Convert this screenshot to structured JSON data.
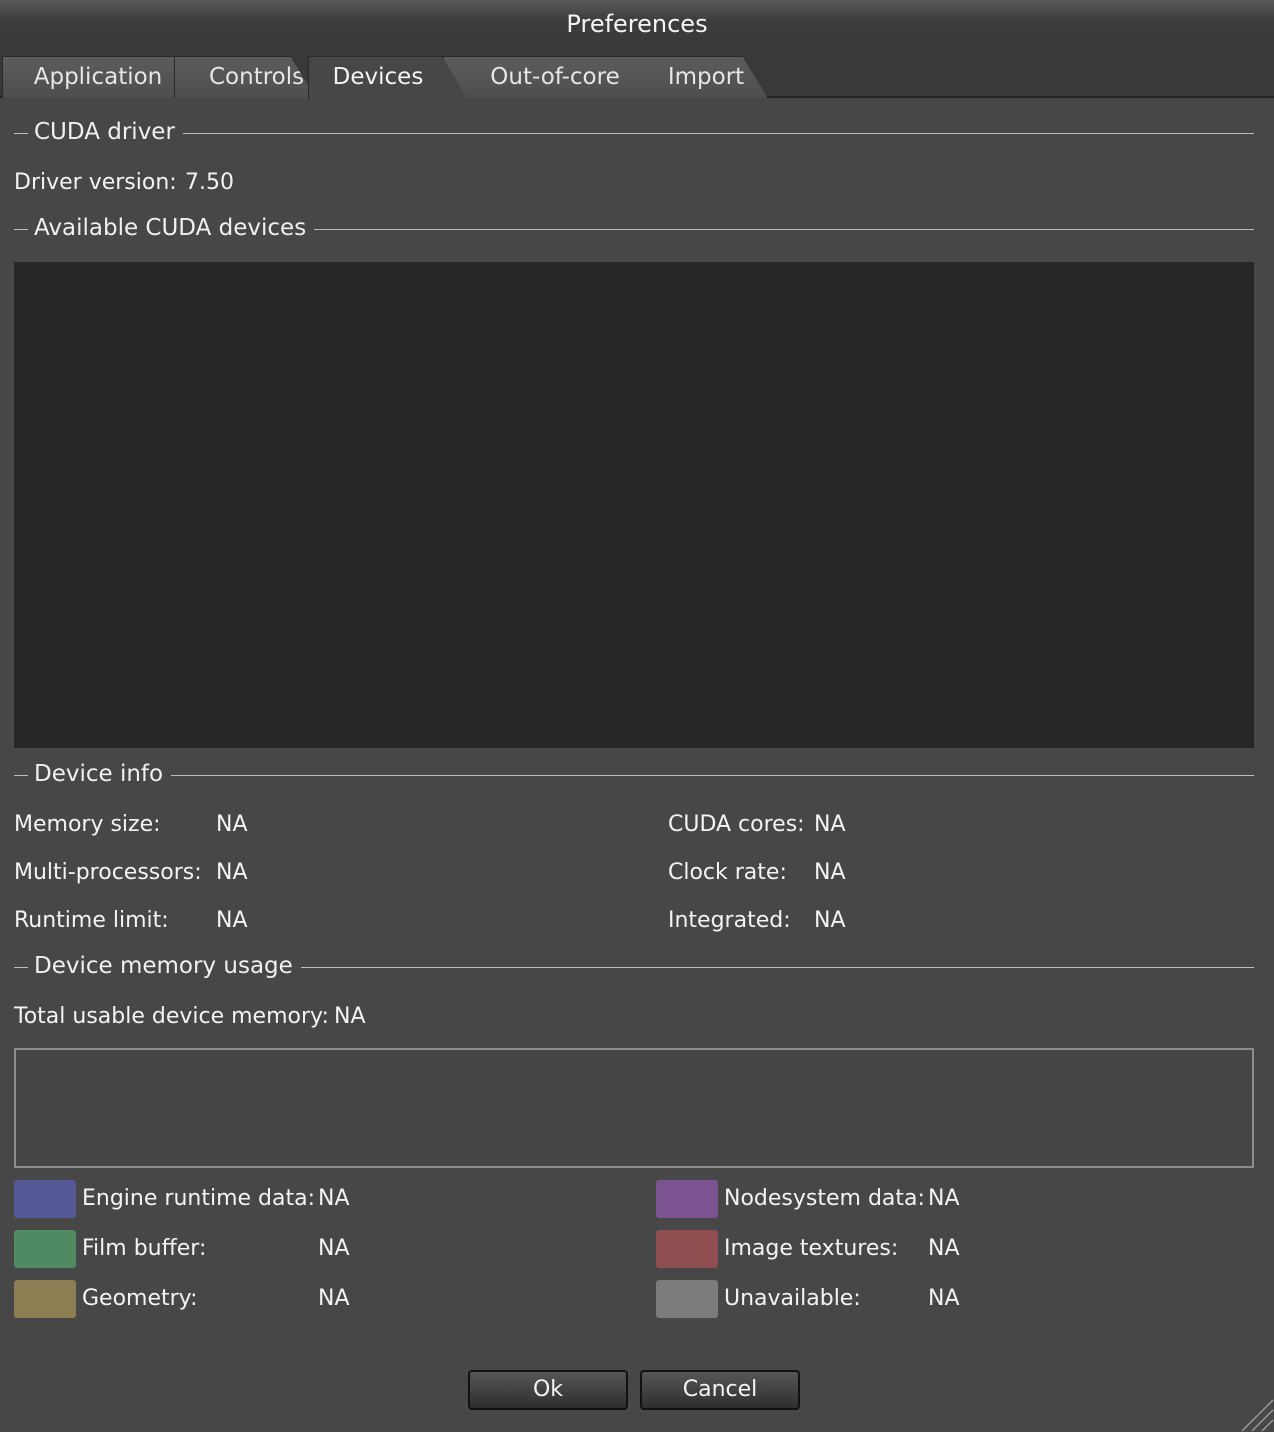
{
  "window": {
    "title": "Preferences"
  },
  "tabs": [
    {
      "label": "Application"
    },
    {
      "label": "Controls"
    },
    {
      "label": "Devices",
      "active": true
    },
    {
      "label": "Out-of-core"
    },
    {
      "label": "Import"
    }
  ],
  "cuda_driver": {
    "heading": "CUDA driver",
    "version_label": "Driver version:",
    "version_value": "7.50"
  },
  "devices": {
    "heading": "Available CUDA devices",
    "items": []
  },
  "device_info": {
    "heading": "Device info",
    "memory_size_label": "Memory size:",
    "memory_size_value": "NA",
    "multi_processors_label": "Multi-processors:",
    "multi_processors_value": "NA",
    "runtime_limit_label": "Runtime limit:",
    "runtime_limit_value": "NA",
    "cuda_cores_label": "CUDA cores:",
    "cuda_cores_value": "NA",
    "clock_rate_label": "Clock rate:",
    "clock_rate_value": "NA",
    "integrated_label": "Integrated:",
    "integrated_value": "NA"
  },
  "memory_usage": {
    "heading": "Device memory usage",
    "total_label": "Total usable device memory:",
    "total_value": "NA",
    "legend": [
      {
        "label": "Engine runtime data:",
        "value": "NA",
        "color": "#555796"
      },
      {
        "label": "Film buffer:",
        "value": "NA",
        "color": "#4f8a62"
      },
      {
        "label": "Geometry:",
        "value": "NA",
        "color": "#8d7d53"
      },
      {
        "label": "Nodesystem data:",
        "value": "NA",
        "color": "#7c5391"
      },
      {
        "label": "Image textures:",
        "value": "NA",
        "color": "#8f4e50"
      },
      {
        "label": "Unavailable:",
        "value": "NA",
        "color": "#7c7c7c"
      }
    ]
  },
  "buttons": {
    "ok_label": "Ok",
    "cancel_label": "Cancel"
  },
  "colors": {
    "background": "#474747",
    "list_background": "#272727"
  }
}
